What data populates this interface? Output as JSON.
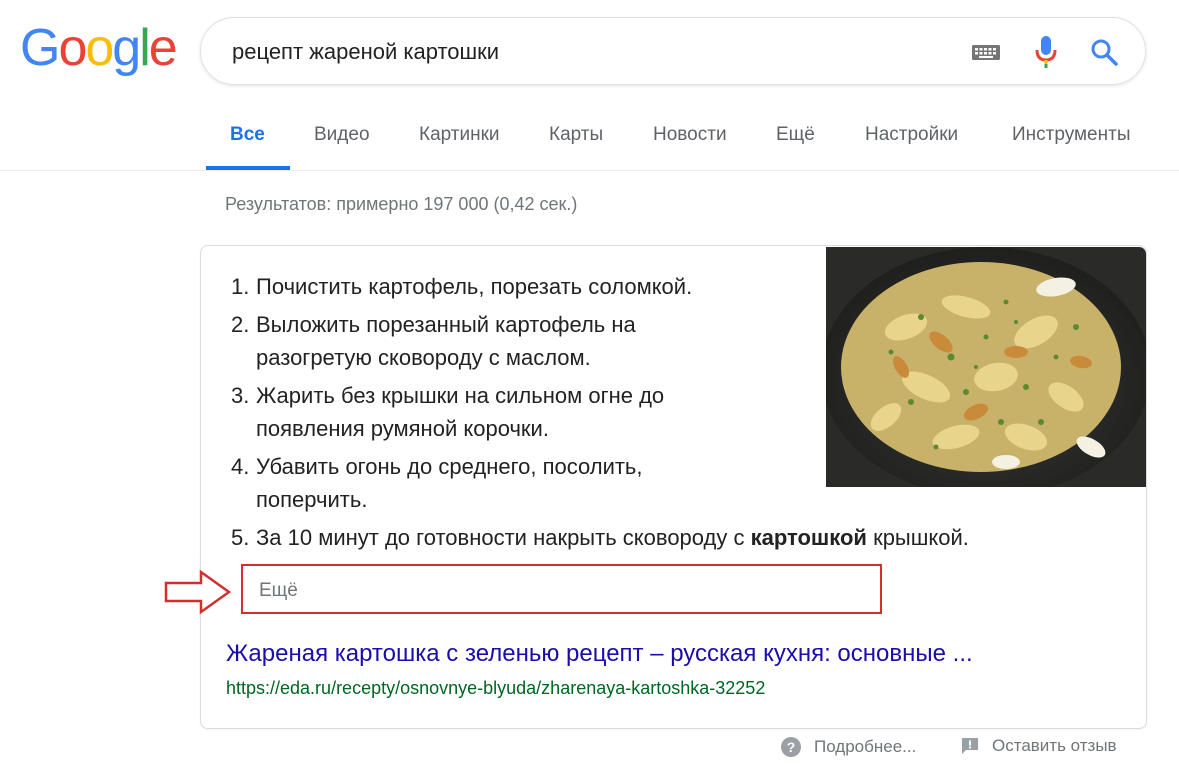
{
  "logo": {
    "letters": [
      "G",
      "o",
      "o",
      "g",
      "l",
      "e"
    ],
    "colors": [
      "#4285F4",
      "#EA4335",
      "#FBBC05",
      "#4285F4",
      "#34A853",
      "#EA4335"
    ]
  },
  "search": {
    "query": "рецепт жареной картошки",
    "icons": [
      "keyboard-icon",
      "microphone-icon",
      "search-icon"
    ]
  },
  "tabs": [
    {
      "label": "Все",
      "active": true
    },
    {
      "label": "Видео"
    },
    {
      "label": "Картинки"
    },
    {
      "label": "Карты"
    },
    {
      "label": "Новости"
    },
    {
      "label": "Ещё"
    },
    {
      "label": "Настройки"
    },
    {
      "label": "Инструменты"
    }
  ],
  "results_stats": "Результатов: примерно 197 000 (0,42 сек.)",
  "snippet": {
    "steps": [
      {
        "num": "1.",
        "text": "Почистить картофель, порезать соломкой."
      },
      {
        "num": "2.",
        "text": "Выложить порезанный картофель на разогретую сковороду с маслом."
      },
      {
        "num": "3.",
        "text": "Жарить без крышки на сильном огне до появления румяной корочки."
      },
      {
        "num": "4.",
        "text": "Убавить огонь до среднего, посолить, поперчить."
      },
      {
        "num": "5.",
        "text_before": "За 10 минут до готовности накрыть сковороду с ",
        "bold": "картошкой",
        "text_after": " крышкой."
      }
    ],
    "more_label": "Ещё",
    "result_title": "Жареная картошка с зеленью рецепт – русская кухня: основные ...",
    "result_url": "https://eda.ru/recepty/osnovnye-blyuda/zharenaya-kartoshka-32252"
  },
  "footer": {
    "about": "Подробнее...",
    "feedback": "Оставить отзыв"
  },
  "colors": {
    "accent": "#1a73e8",
    "link": "#1a0dab",
    "url": "#006621",
    "highlight": "#d32f2f"
  }
}
